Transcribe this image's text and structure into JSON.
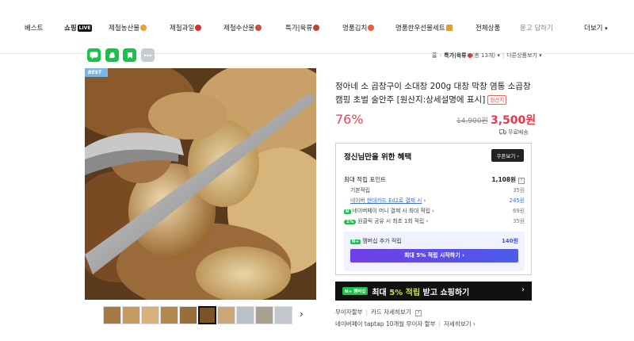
{
  "nav": {
    "items": [
      "베스트",
      "쇼핑",
      "제철농산물",
      "제철과일",
      "제철수산물",
      "특가|육류",
      "명품김치",
      "명품한우선물세트",
      "전체상품",
      "묻고 답하기",
      "더보기"
    ],
    "live_badge": "LIVE"
  },
  "share_icons": [
    "talk-icon",
    "band-icon",
    "blog-icon",
    "more-icon"
  ],
  "breadcrumb": {
    "home": "홈",
    "category": "특가|육류",
    "count": "(총 13개)",
    "other": "다른상품보기"
  },
  "product": {
    "best_tag": "BEST",
    "title": "정아네 소 곱창구이 소대창 200g 대창 막창 염통 소곱창 캠핑 초벌 술안주 [원산지:상세설명에 표시]",
    "origin_badge": "원산지",
    "discount": "76%",
    "original_price": "14,900원",
    "sale_price": "3,500원",
    "shipping": "무료배송"
  },
  "benefit": {
    "title": "정신님만을 위한 혜택",
    "coupon_button": "쿠폰보기",
    "max_label": "최대 적립 포인트",
    "max_value": "1,108원",
    "rows": [
      {
        "label": "기본적립",
        "value": "35원"
      },
      {
        "label": "네이버 현대카드 Ed2로 결제 시",
        "value": "245원"
      },
      {
        "label": "네이버페이 머니 결제 시 최대 적립",
        "value": "69원"
      },
      {
        "label": "원클릭 공유 시 최초 1회 적립",
        "value": "35원"
      }
    ],
    "n_badge": "N",
    "pct_badge": "1%",
    "member_label": "멤버십 추가 적립",
    "member_value": "140원",
    "member_button": "최대 5% 적립 시작하기"
  },
  "banner": {
    "badge": "멤버십",
    "text_pre": "최대 ",
    "text_hl": "5% 적립",
    "text_post": " 받고 쇼핑하기"
  },
  "pay": {
    "row1_a": "무이자할부",
    "row1_b": "카드 자세히보기",
    "row2_a": "네이버페이 taptap 10개월 무이자 할부",
    "row2_b": "자세히보기"
  },
  "colors": {
    "accent_red": "#e83748",
    "discount_pink": "#ec4158",
    "naver_green": "#19c34a",
    "member_purple": "#6f3fe6"
  }
}
